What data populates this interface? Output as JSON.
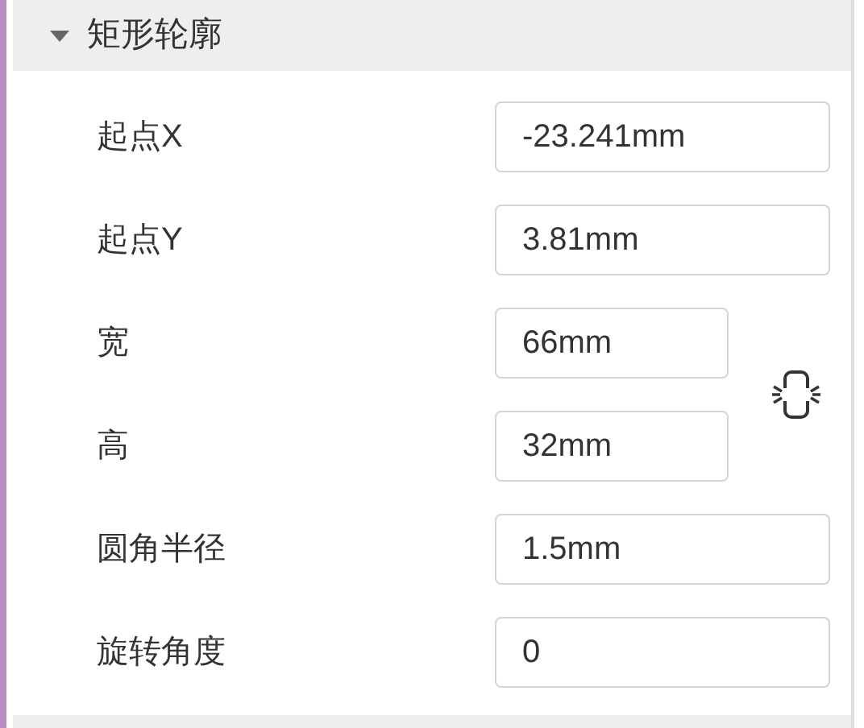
{
  "section": {
    "title": "矩形轮廓",
    "expanded": true
  },
  "rows": [
    {
      "kind": "field",
      "label": "起点X",
      "value": "-23.241mm"
    },
    {
      "kind": "field",
      "label": "起点Y",
      "value": "3.81mm"
    },
    {
      "kind": "linked_pair",
      "locked": false,
      "fields": [
        {
          "label": "宽",
          "value": "66mm"
        },
        {
          "label": "高",
          "value": "32mm"
        }
      ]
    },
    {
      "kind": "field",
      "label": "圆角半径",
      "value": "1.5mm"
    },
    {
      "kind": "field",
      "label": "旋转角度",
      "value": "0"
    }
  ]
}
